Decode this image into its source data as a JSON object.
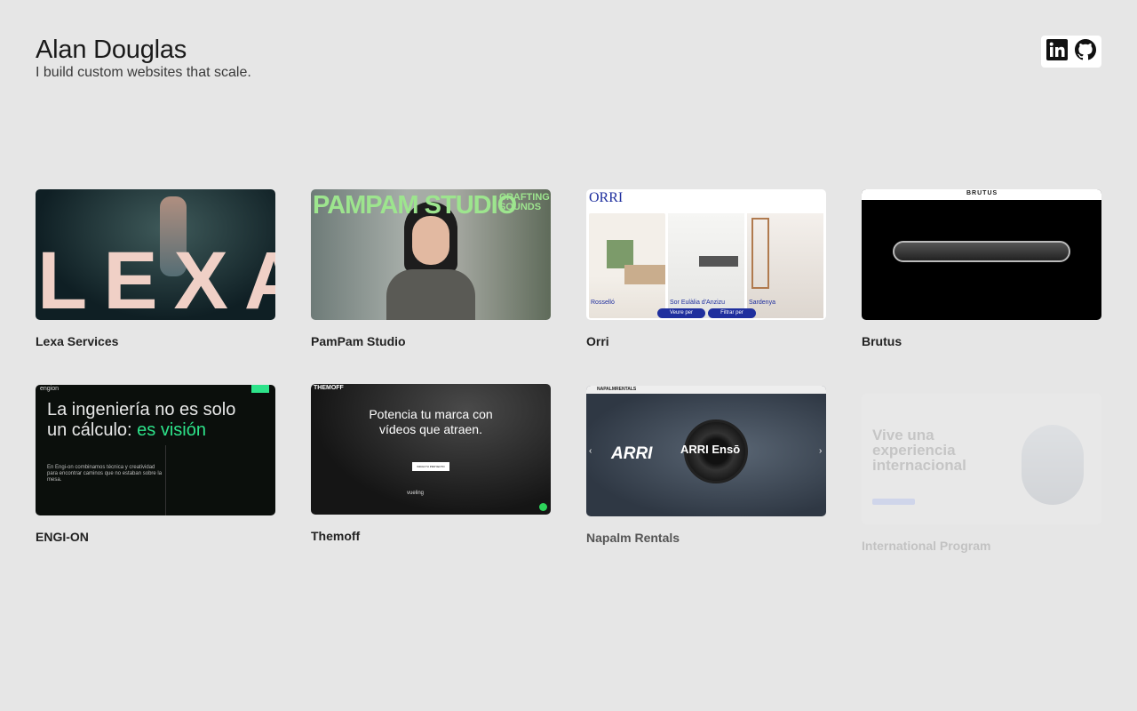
{
  "header": {
    "name": "Alan Douglas",
    "tagline": "I build custom websites that scale."
  },
  "social": [
    {
      "icon": "linkedin-icon"
    },
    {
      "icon": "github-icon"
    }
  ],
  "projects": [
    {
      "title": "Lexa Services",
      "thumb": {
        "logo": "LEXA"
      }
    },
    {
      "title": "PamPam Studio",
      "thumb": {
        "headline": "PAMPAM STUDIO",
        "sub": "CRAFTING SOUNDS"
      }
    },
    {
      "title": "Orri",
      "thumb": {
        "logo": "ORRI",
        "items": [
          "Rosselló",
          "Sor Eulàlia d'Anzizu",
          "Sardenya"
        ],
        "btn1": "Veure per",
        "btn2": "Filtrar per"
      }
    },
    {
      "title": "Brutus",
      "thumb": {
        "logo": "BRUTUS"
      }
    },
    {
      "title": "ENGI-ON",
      "thumb": {
        "logo": "engion",
        "headline1": "La ingeniería no es solo",
        "headline2": "un cálculo: ",
        "accent": "es visión",
        "body": "En Engi-on combinamos técnica y creatividad para encontrar caminos que no estaban sobre la mesa."
      }
    },
    {
      "title": "Themoff",
      "thumb": {
        "logo": "THEMOFF",
        "headline1": "Potencia tu marca con",
        "headline2": "vídeos que atraen.",
        "cta": "INICIA TU PROYECTO",
        "client": "vueling"
      }
    },
    {
      "title": "Napalm Rentals",
      "thumb": {
        "logo": "NAPALMRENTALS",
        "brand": "ARRI",
        "product": "ARRI Ensō"
      }
    },
    {
      "title": "International Program",
      "thumb": {
        "headline": "Vive una experiencia internacional"
      }
    }
  ],
  "colors": {
    "bg": "#e6e6e6",
    "engion_accent": "#2de38a",
    "orri_blue": "#1f2f9e"
  }
}
